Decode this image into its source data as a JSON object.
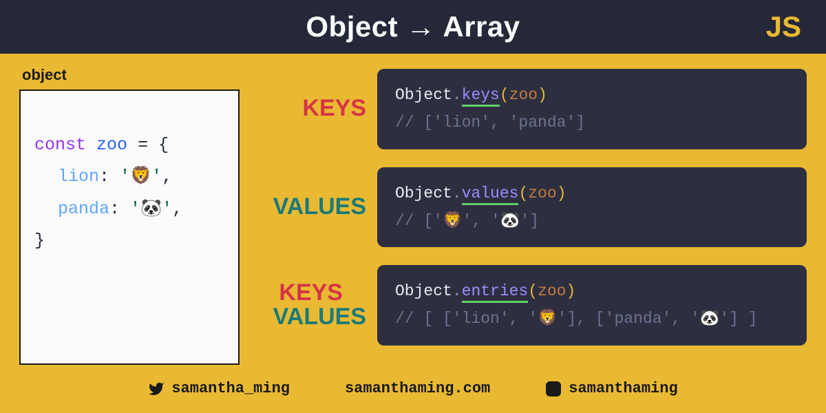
{
  "header": {
    "title": "Object → Array",
    "badge": "JS"
  },
  "object_panel": {
    "label": "object",
    "code": {
      "keyword": "const",
      "name": "zoo",
      "eq": "=",
      "open": "{",
      "prop1_key": "lion",
      "prop1_colon": ":",
      "prop1_val": "'🦁'",
      "prop1_comma": ",",
      "prop2_key": "panda",
      "prop2_colon": ":",
      "prop2_val": "'🐼'",
      "prop2_comma": ",",
      "close": "}"
    }
  },
  "rows": {
    "keys": {
      "label": "KEYS",
      "obj": "Object",
      "dot": ".",
      "method": "keys",
      "lp": "(",
      "arg": "zoo",
      "rp": ")",
      "comment": "// ['lion', 'panda']"
    },
    "values": {
      "label": "VALUES",
      "obj": "Object",
      "dot": ".",
      "method": "values",
      "lp": "(",
      "arg": "zoo",
      "rp": ")",
      "comment": "// ['🦁', '🐼']"
    },
    "entries": {
      "label_l1a": "KEYS",
      "label_l1b": "&",
      "label_l2": "VALUES",
      "obj": "Object",
      "dot": ".",
      "method": "entries",
      "lp": "(",
      "arg": "zoo",
      "rp": ")",
      "comment": "// [ ['lion', '🦁'], ['panda', '🐼'] ]"
    }
  },
  "footer": {
    "twitter": "samantha_ming",
    "site": "samanthaming.com",
    "instagram": "samanthaming"
  }
}
